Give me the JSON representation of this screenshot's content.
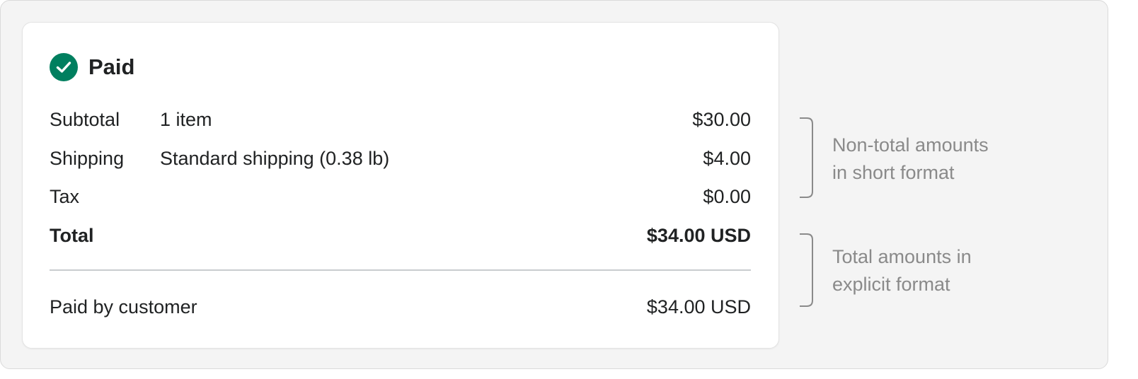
{
  "status": {
    "label": "Paid",
    "icon": "check-circle-icon",
    "color": "#007f5f"
  },
  "rows": [
    {
      "label": "Subtotal",
      "description": "1 item",
      "amount": "$30.00"
    },
    {
      "label": "Shipping",
      "description": "Standard shipping (0.38 lb)",
      "amount": "$4.00"
    },
    {
      "label": "Tax",
      "description": "",
      "amount": "$0.00"
    }
  ],
  "total": {
    "label": "Total",
    "amount": "$34.00 USD"
  },
  "paid_by": {
    "label": "Paid by customer",
    "amount": "$34.00 USD"
  },
  "annotations": [
    {
      "lines": [
        "Non-total amounts",
        "in short format"
      ]
    },
    {
      "lines": [
        "Total amounts in",
        "explicit format"
      ]
    }
  ],
  "colors": {
    "annotation_text": "#8a8a8a",
    "bracket": "#8a8a8a",
    "divider": "#c9cccf"
  }
}
